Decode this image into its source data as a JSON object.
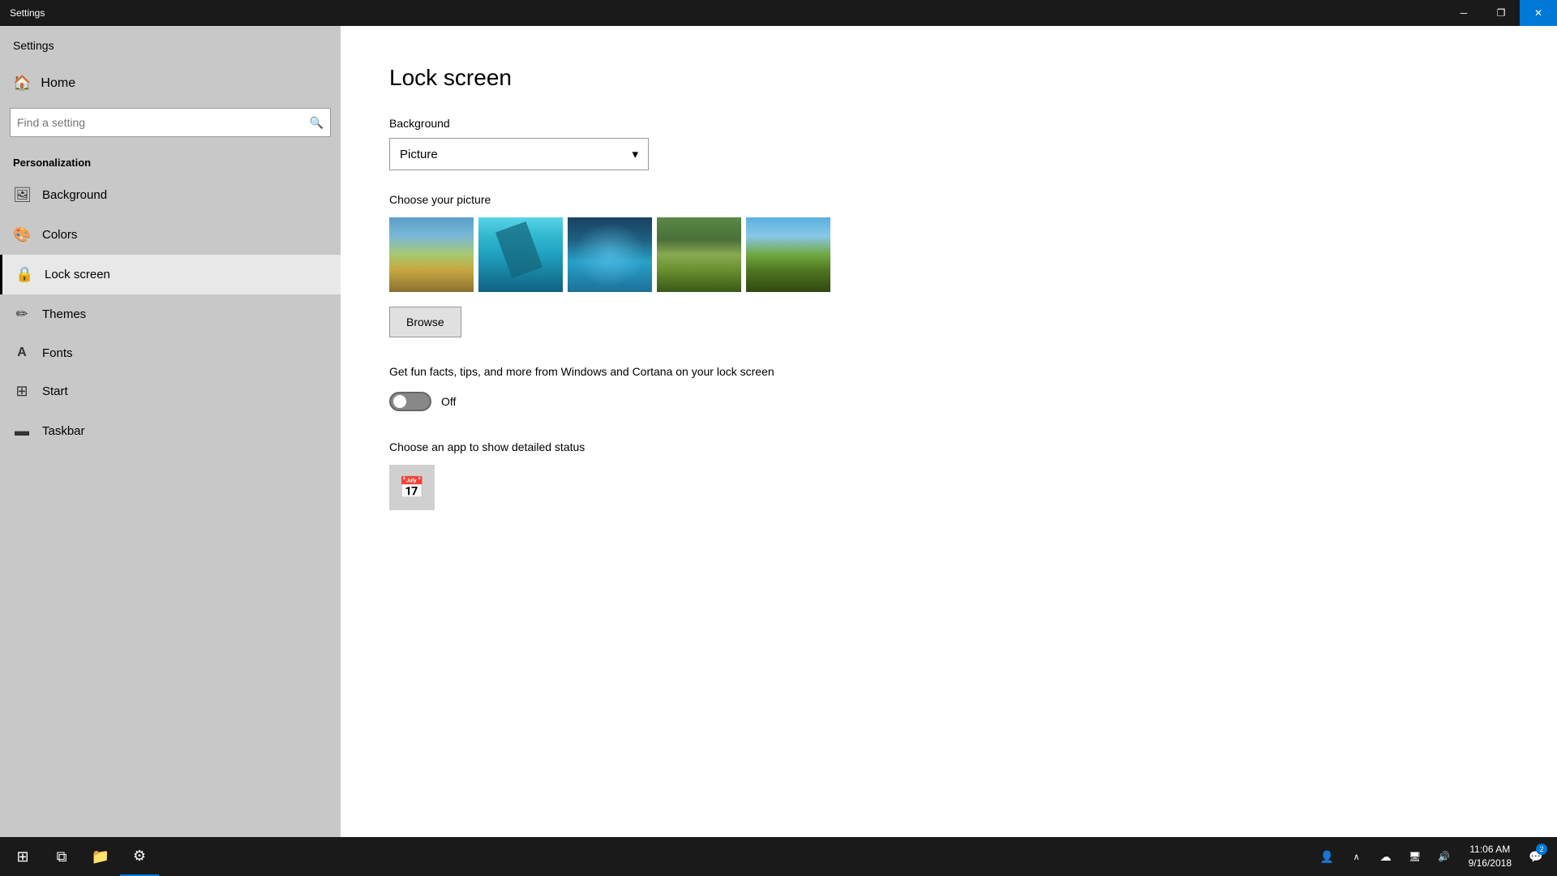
{
  "titlebar": {
    "title": "Settings",
    "minimize_label": "─",
    "restore_label": "❐",
    "close_label": "✕"
  },
  "sidebar": {
    "app_title": "Settings",
    "home_label": "Home",
    "search_placeholder": "Find a setting",
    "section_title": "Personalization",
    "items": [
      {
        "id": "background",
        "label": "Background",
        "icon": "🖼"
      },
      {
        "id": "colors",
        "label": "Colors",
        "icon": "🎨"
      },
      {
        "id": "lock-screen",
        "label": "Lock screen",
        "icon": "🔒",
        "active": true
      },
      {
        "id": "themes",
        "label": "Themes",
        "icon": "✏"
      },
      {
        "id": "fonts",
        "label": "Fonts",
        "icon": "A"
      },
      {
        "id": "start",
        "label": "Start",
        "icon": "⊞"
      },
      {
        "id": "taskbar",
        "label": "Taskbar",
        "icon": "▬"
      }
    ]
  },
  "main": {
    "page_title": "Lock screen",
    "background_label": "Background",
    "dropdown_value": "Picture",
    "dropdown_arrow": "▾",
    "choose_picture_label": "Choose your picture",
    "browse_label": "Browse",
    "cortana_text": "Get fun facts, tips, and more from Windows and Cortana on your lock screen",
    "toggle_state": "Off",
    "app_status_label": "Choose an app to show detailed status"
  },
  "taskbar": {
    "start_icon": "⊞",
    "apps": [
      {
        "id": "task-view",
        "icon": "⧉"
      },
      {
        "id": "file-explorer",
        "icon": "📁"
      },
      {
        "id": "settings",
        "icon": "⚙"
      }
    ],
    "sys_icons": [
      {
        "id": "people",
        "icon": "👤"
      },
      {
        "id": "chevron",
        "icon": "∧"
      },
      {
        "id": "onedrive",
        "icon": "☁"
      },
      {
        "id": "network",
        "icon": "🖥"
      },
      {
        "id": "volume",
        "icon": "🔊"
      }
    ],
    "clock_time": "11:06 AM",
    "clock_date": "9/16/2018",
    "notification_icon": "💬",
    "notification_count": "2"
  }
}
